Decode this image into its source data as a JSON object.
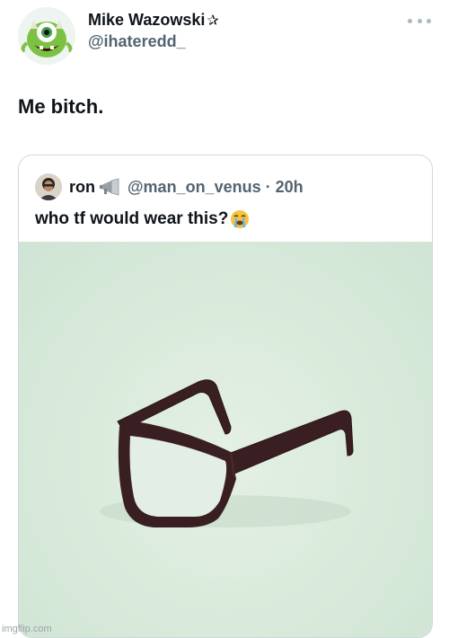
{
  "author": {
    "display_name": "Mike Wazowski",
    "badge": "✰",
    "handle": "@ihateredd_",
    "avatar_icon": "mike-wazowski-avatar"
  },
  "tweet": {
    "text": "Me bitch."
  },
  "quoted": {
    "name": "ron",
    "name_icon": "megaphone-icon",
    "handle": "@man_on_venus",
    "separator": "·",
    "time": "20h",
    "text": "who tf would wear this?",
    "text_emoji": "crying-face-emoji",
    "image_subject": "thick-framed-eyeglasses"
  },
  "watermark": "imgflip.com",
  "colors": {
    "text": "#0f1419",
    "secondary": "#536471",
    "border": "#cfd9de",
    "photo_bg": "#d8eadb",
    "frame": "#3a1f22"
  }
}
